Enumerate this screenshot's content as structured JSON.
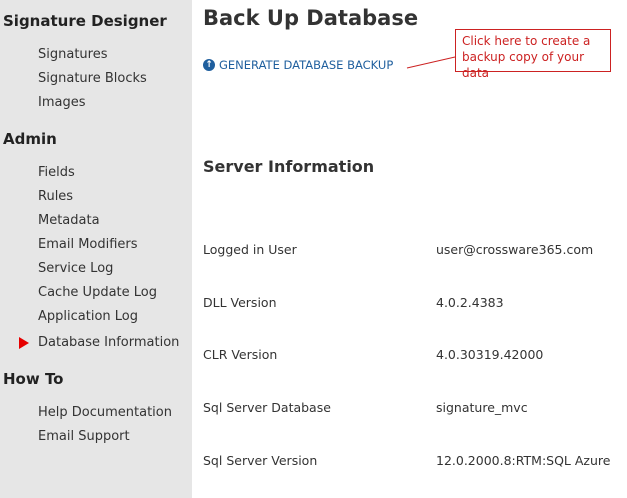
{
  "sidebar": {
    "sections": [
      {
        "title": "Signature Designer",
        "items": [
          "Signatures",
          "Signature Blocks",
          "Images"
        ]
      },
      {
        "title": "Admin",
        "items": [
          "Fields",
          "Rules",
          "Metadata",
          "Email Modifiers",
          "Service Log",
          "Cache Update Log",
          "Application Log",
          "Database Information"
        ]
      },
      {
        "title": "How To",
        "items": [
          "Help Documentation",
          "Email Support"
        ]
      }
    ],
    "active_item": "Database Information"
  },
  "main": {
    "title": "Back Up Database",
    "backup_link": "GENERATE DATABASE BACKUP",
    "callout_line1": "Click here to create a",
    "callout_line2": "backup copy of your data",
    "server_section_title": "Server Information",
    "info": [
      {
        "label": "Logged in User",
        "value": "user@crossware365.com"
      },
      {
        "label": "DLL Version",
        "value": "4.0.2.4383"
      },
      {
        "label": "CLR Version",
        "value": "4.0.30319.42000"
      },
      {
        "label": "Sql Server Database",
        "value": "signature_mvc"
      },
      {
        "label": "Sql Server Version",
        "value": "12.0.2000.8:RTM:SQL Azure"
      }
    ]
  },
  "colors": {
    "sidebar_bg": "#e6e6e6",
    "link": "#1f5f9e",
    "callout": "#cc2222",
    "active_marker": "#e60000"
  }
}
